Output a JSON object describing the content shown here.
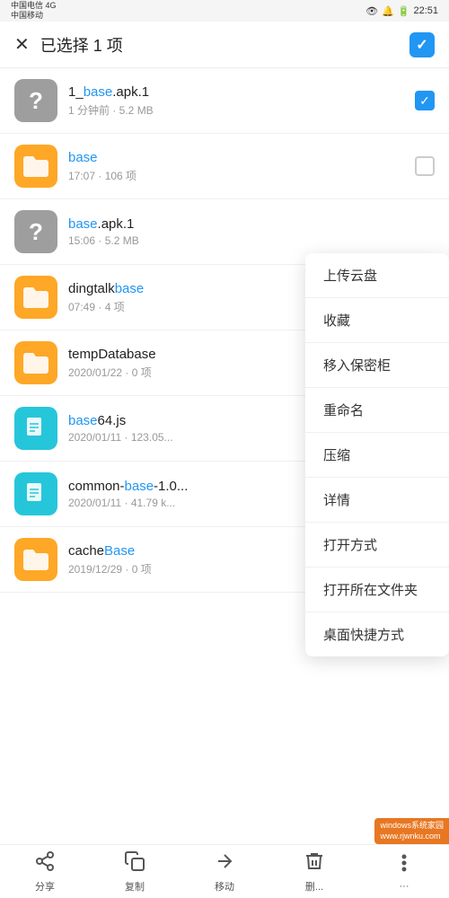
{
  "statusBar": {
    "carrier1": "中国电信 4G",
    "carrier2": "中国移动",
    "time": "22:51"
  },
  "header": {
    "title": "已选择 1 项",
    "closeIcon": "×"
  },
  "files": [
    {
      "id": "file1",
      "type": "apk",
      "nameParts": [
        {
          "text": "1_",
          "highlight": false
        },
        {
          "text": "base",
          "highlight": true
        },
        {
          "text": ".apk.1",
          "highlight": false
        }
      ],
      "nameDisplay": "1_base.apk.1",
      "meta": "1 分钟前 · 5.2 MB",
      "checked": true
    },
    {
      "id": "file2",
      "type": "folder",
      "nameParts": [
        {
          "text": "base",
          "highlight": true
        }
      ],
      "nameDisplay": "base",
      "meta": "17:07 · 106 项",
      "checked": false
    },
    {
      "id": "file3",
      "type": "apk",
      "nameParts": [
        {
          "text": "base",
          "highlight": true
        },
        {
          "text": ".apk.1",
          "highlight": false
        }
      ],
      "nameDisplay": "base.apk.1",
      "meta": "15:06 · 5.2 MB",
      "checked": false,
      "hasMenu": true
    },
    {
      "id": "file4",
      "type": "folder",
      "nameParts": [
        {
          "text": "dingtalk",
          "highlight": false
        },
        {
          "text": "base",
          "highlight": true
        }
      ],
      "nameDisplay": "dingtalkbase",
      "meta": "07:49 · 4 项",
      "checked": false
    },
    {
      "id": "file5",
      "type": "folder",
      "nameParts": [
        {
          "text": "tempDatabase",
          "highlight": false
        }
      ],
      "nameDisplay": "tempDatabase",
      "meta": "2020/01/22 · 0 项",
      "checked": false
    },
    {
      "id": "file6",
      "type": "doc",
      "nameParts": [
        {
          "text": "base",
          "highlight": true
        },
        {
          "text": "64.js",
          "highlight": false
        }
      ],
      "nameDisplay": "base64.js",
      "meta": "2020/01/11 · 123.05...",
      "checked": false
    },
    {
      "id": "file7",
      "type": "doc",
      "nameParts": [
        {
          "text": "common-",
          "highlight": false
        },
        {
          "text": "base",
          "highlight": true
        },
        {
          "text": "-1.0...",
          "highlight": false
        }
      ],
      "nameDisplay": "common-base-1.0...",
      "meta": "2020/01/11 · 41.79 k...",
      "checked": false
    },
    {
      "id": "file8",
      "type": "folder",
      "nameParts": [
        {
          "text": "cache",
          "highlight": false
        },
        {
          "text": "Base",
          "highlight": true
        }
      ],
      "nameDisplay": "cacheBase",
      "meta": "2019/12/29 · 0 项",
      "checked": false
    }
  ],
  "contextMenu": {
    "items": [
      "上传云盘",
      "收藏",
      "移入保密柜",
      "重命名",
      "压缩",
      "详情",
      "打开方式",
      "打开所在文件夹",
      "桌面快捷方式"
    ]
  },
  "toolbar": {
    "buttons": [
      {
        "label": "分享",
        "icon": "share"
      },
      {
        "label": "复制",
        "icon": "copy"
      },
      {
        "label": "移动",
        "icon": "move"
      },
      {
        "label": "删...",
        "icon": "delete"
      },
      {
        "label": "···",
        "icon": "more"
      }
    ]
  },
  "watermark": {
    "line1": "windows系统家园",
    "line2": "www.rjwnku.com"
  }
}
